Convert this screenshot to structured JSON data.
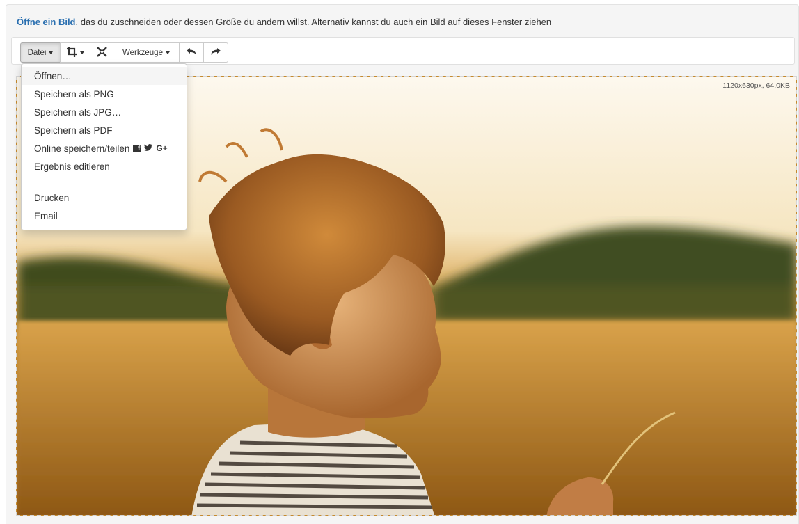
{
  "intro": {
    "link_text": "Öffne ein Bild",
    "text": ", das du zuschneiden oder dessen Größe du ändern willst. Alternativ kannst du auch ein Bild auf dieses Fenster ziehen"
  },
  "toolbar": {
    "datei_label": "Datei",
    "tools_label": "Werkzeuge",
    "icons": {
      "crop": "crop-icon",
      "resize": "resize-icon",
      "undo": "undo-icon",
      "redo": "redo-icon"
    }
  },
  "menu": {
    "items": [
      {
        "label": "Öffnen…"
      },
      {
        "label": "Speichern als PNG"
      },
      {
        "label": "Speichern als JPG…"
      },
      {
        "label": "Speichern als PDF"
      },
      {
        "label": "Online speichern/teilen"
      },
      {
        "label": "Ergebnis editieren"
      },
      {
        "label": "Drucken"
      },
      {
        "label": "Email"
      }
    ],
    "social": {
      "facebook": "f",
      "twitter": "🐦",
      "google": "G+"
    }
  },
  "image": {
    "size_info": "1120x630px, 64.0KB"
  },
  "colors": {
    "link": "#2a6fb0",
    "photo_sky": "#fdf6e6",
    "photo_field": "#c8892c",
    "photo_trees": "#4a5a22"
  }
}
